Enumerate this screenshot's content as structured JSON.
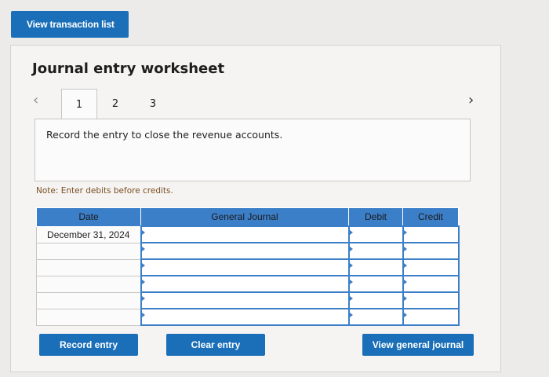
{
  "header": {
    "view_transactions_label": "View transaction list"
  },
  "worksheet": {
    "title": "Journal entry worksheet",
    "tabs": [
      {
        "label": "1"
      },
      {
        "label": "2"
      },
      {
        "label": "3"
      }
    ],
    "active_tab": 1,
    "instruction": "Record the entry to close the revenue accounts.",
    "note": "Note: Enter debits before credits.",
    "table": {
      "headers": {
        "date": "Date",
        "general_journal": "General Journal",
        "debit": "Debit",
        "credit": "Credit"
      },
      "rows": [
        {
          "date": "December 31, 2024",
          "account": "",
          "debit": "",
          "credit": ""
        },
        {
          "date": "",
          "account": "",
          "debit": "",
          "credit": ""
        },
        {
          "date": "",
          "account": "",
          "debit": "",
          "credit": ""
        },
        {
          "date": "",
          "account": "",
          "debit": "",
          "credit": ""
        },
        {
          "date": "",
          "account": "",
          "debit": "",
          "credit": ""
        },
        {
          "date": "",
          "account": "",
          "debit": "",
          "credit": ""
        }
      ]
    },
    "buttons": {
      "record_entry": "Record entry",
      "clear_entry": "Clear entry",
      "view_general_journal": "View general journal"
    }
  },
  "icons": {
    "prev": "chevron-left-icon",
    "next": "chevron-right-icon"
  },
  "colors": {
    "accent": "#1a6fb8",
    "table_header": "#3c7fc9"
  }
}
